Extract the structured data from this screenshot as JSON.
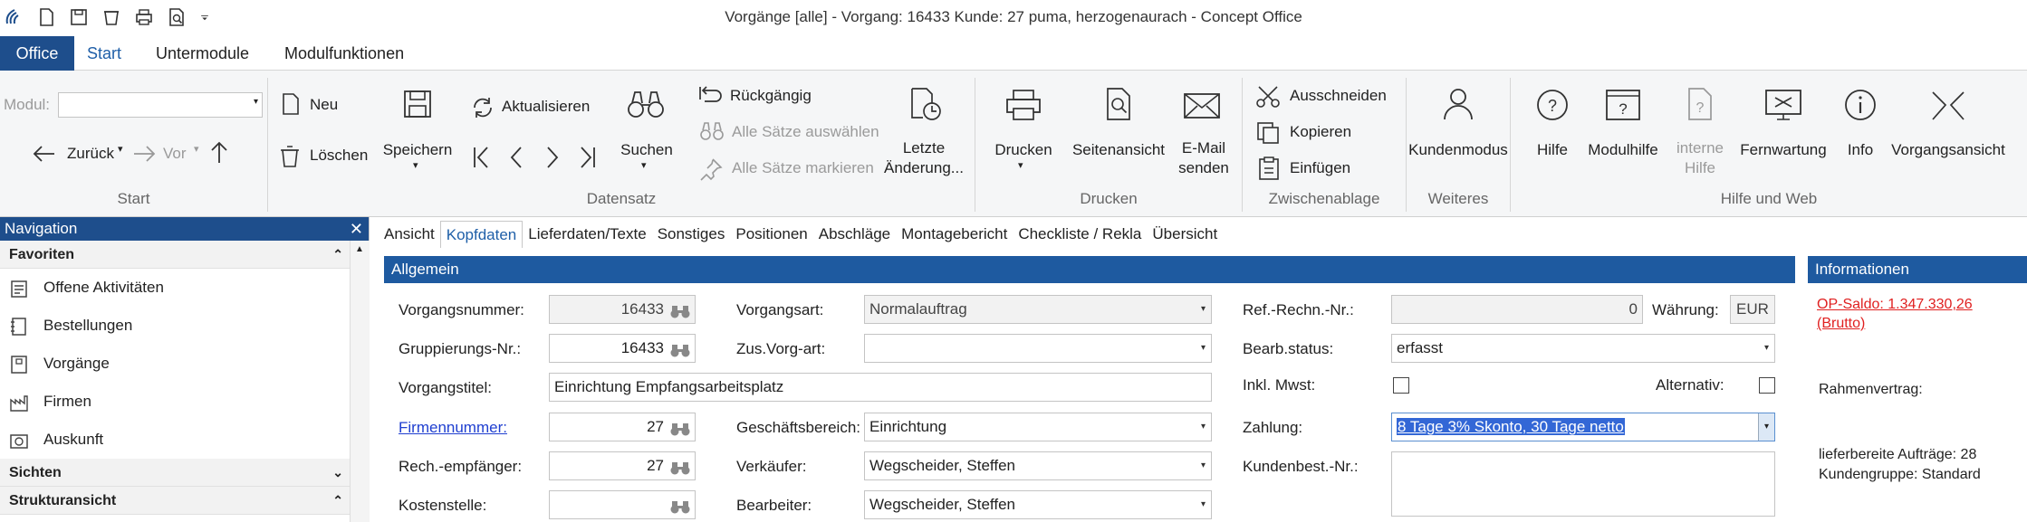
{
  "window": {
    "title": "Vorgänge [alle] - Vorgang: 16433 Kunde: 27 puma, herzogenaurach - Concept Office"
  },
  "quick_access": {
    "icons": [
      "app-logo-icon",
      "new-document-icon",
      "save-icon",
      "delete-icon",
      "print-icon",
      "print-preview-icon",
      "customize-qat-icon"
    ]
  },
  "menu": {
    "office": "Office",
    "tabs": [
      "Start",
      "Untermodule",
      "Modulfunktionen"
    ]
  },
  "ribbon": {
    "start_group": {
      "modul_label": "Modul:",
      "back": "Zurück",
      "forward": "Vor",
      "label": "Start"
    },
    "datensatz": {
      "neu": "Neu",
      "loeschen": "Löschen",
      "speichern": "Speichern",
      "aktualisieren": "Aktualisieren",
      "suchen": "Suchen",
      "rueckgaengig": "Rückgängig",
      "alle_auswaehlen": "Alle Sätze auswählen",
      "alle_markieren": "Alle Sätze markieren",
      "letzte_line1": "Letzte",
      "letzte_line2": "Änderung...",
      "label": "Datensatz"
    },
    "drucken": {
      "drucken": "Drucken",
      "seitenansicht": "Seitenansicht",
      "email_line1": "E-Mail",
      "email_line2": "senden",
      "label": "Drucken"
    },
    "zwischenablage": {
      "ausschneiden": "Ausschneiden",
      "kopieren": "Kopieren",
      "einfuegen": "Einfügen",
      "label": "Zwischenablage"
    },
    "weiteres": {
      "kundenmodus": "Kundenmodus",
      "label": "Weiteres"
    },
    "hilfe": {
      "hilfe": "Hilfe",
      "modulhilfe": "Modulhilfe",
      "interne_line1": "interne",
      "interne_line2": "Hilfe",
      "fernwartung": "Fernwartung",
      "info": "Info",
      "vorgangsansicht": "Vorgangsansicht",
      "label": "Hilfe und Web"
    }
  },
  "navigation": {
    "header": "Navigation",
    "favoriten": "Favoriten",
    "items": [
      "Offene Aktivitäten",
      "Bestellungen",
      "Vorgänge",
      "Firmen",
      "Auskunft"
    ],
    "sichten": "Sichten",
    "strukturansicht": "Strukturansicht"
  },
  "content_tabs": [
    "Ansicht",
    "Kopfdaten",
    "Lieferdaten/Texte",
    "Sonstiges",
    "Positionen",
    "Abschläge",
    "Montagebericht",
    "Checkliste / Rekla",
    "Übersicht"
  ],
  "form": {
    "section": "Allgemein",
    "vorgangsnummer_label": "Vorgangsnummer:",
    "vorgangsnummer": "16433",
    "gruppierung_label": "Gruppierungs-Nr.:",
    "gruppierung": "16433",
    "vorgangstitel_label": "Vorgangstitel:",
    "vorgangstitel": "Einrichtung Empfangsarbeitsplatz",
    "firmennummer_label": "Firmennummer:",
    "firmennummer": "27",
    "rechempf_label": "Rech.-empfänger:",
    "rechempf": "27",
    "kostenstelle_label": "Kostenstelle:",
    "kostenstelle": "",
    "vorgangsart_label": "Vorgangsart:",
    "vorgangsart": "Normalauftrag",
    "zusvorgart_label": "Zus.Vorg-art:",
    "zusvorgart": "",
    "geschaeftsbereich_label": "Geschäftsbereich:",
    "geschaeftsbereich": "Einrichtung",
    "verkaeufer_label": "Verkäufer:",
    "verkaeufer": "Wegscheider, Steffen",
    "bearbeiter_label": "Bearbeiter:",
    "bearbeiter": "Wegscheider, Steffen",
    "refrechn_label": "Ref.-Rechn.-Nr.:",
    "refrechn": "0",
    "waehrung_label": "Währung:",
    "waehrung": "EUR",
    "bearbstatus_label": "Bearb.status:",
    "bearbstatus": "erfasst",
    "inklmwst_label": "Inkl. Mwst:",
    "alternativ_label": "Alternativ:",
    "zahlung_label": "Zahlung:",
    "zahlung": "8 Tage 3% Skonto, 30 Tage netto",
    "kundenbest_label": "Kundenbest.-Nr.:",
    "kundenbest": ""
  },
  "info_panel": {
    "header": "Informationen",
    "op_saldo_line1": "OP-Saldo: 1.347.330,26",
    "op_saldo_line2": "(Brutto)",
    "rahmenvertrag": "Rahmenvertrag:",
    "lieferbereit": "lieferbereite Aufträge: 28",
    "kundengruppe": "Kundengruppe: Standard"
  },
  "colors": {
    "accent": "#1e4e8c",
    "panel_bar": "#1e5aa0",
    "link": "#1f3fd0",
    "alert": "#e02020",
    "selection": "#3367d6"
  }
}
